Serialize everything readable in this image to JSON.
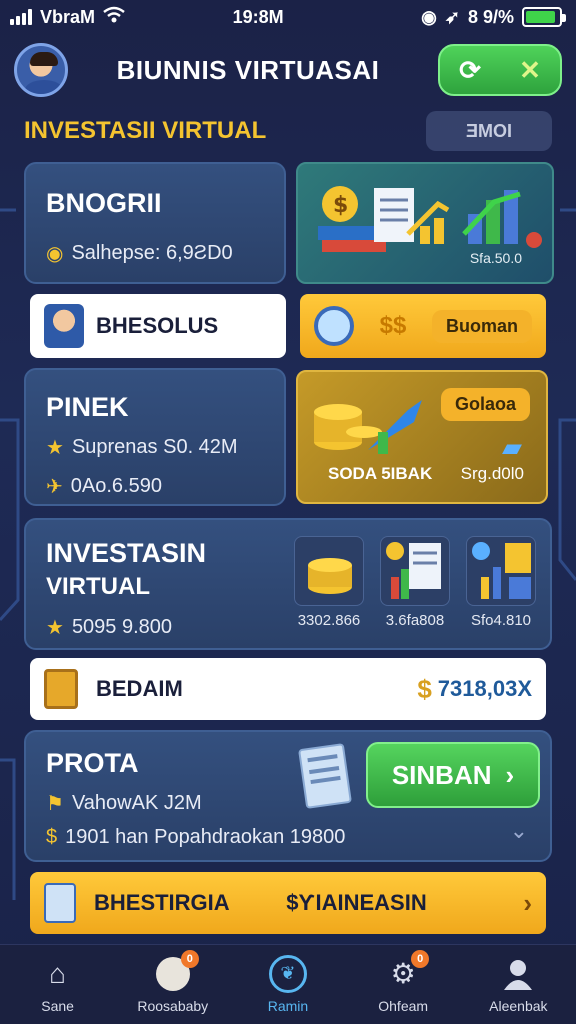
{
  "status_bar": {
    "carrier": "VbraM",
    "time": "19:8M",
    "battery_text": "8 9/%",
    "battery_level": 0.9
  },
  "header": {
    "title": "BIUNNIS VIRTUASAI",
    "left_icon": "avatar",
    "actions": [
      "refresh-icon",
      "tools-icon"
    ]
  },
  "section": {
    "title": "INVESTASII VIRTUAL",
    "tag": "ƎMOI"
  },
  "card_brogrii": {
    "title": "BNOGRII",
    "meta": "Salhepse: 6,9ƧD0",
    "image_caption": "Sfa.50.0"
  },
  "bar_bhesolus": {
    "label": "BHESOLUS",
    "yellow_label": "Buoman"
  },
  "card_pinek": {
    "title": "PINEK",
    "meta1": "Suprenas S0. 42M",
    "meta2": "0Ao.6.590",
    "image_label": "SODA 5IBAK",
    "badge": "Golaoa",
    "badge_caption": "Srg.d0l0"
  },
  "card_investasi": {
    "title_line1": "INVESTASIN",
    "title_line2": "VIRTUAL",
    "meta": "5095 9.800",
    "tiles": [
      {
        "icon": "coins-icon",
        "label": "3302.866"
      },
      {
        "icon": "chart-report-icon",
        "label": "3.6fa808"
      },
      {
        "icon": "growth-chart-icon",
        "label": "Sfo4.810"
      }
    ]
  },
  "bar_bedaim": {
    "label": "BEDAIM",
    "amount": "7318,03X"
  },
  "card_prota": {
    "title": "PROTA",
    "meta1": "VahowAK J2M",
    "meta2": "1901 han Popahdraokan 19800",
    "button_label": "SINBAN"
  },
  "bar_bhestirgia": {
    "label": "BHESTIRGIA",
    "value": "$ƳIAINEASIN"
  },
  "bottom_nav": [
    {
      "label": "Sane",
      "icon": "home-icon",
      "active": false,
      "badge": ""
    },
    {
      "label": "Roosababy",
      "icon": "piggy-icon",
      "active": false,
      "badge": "0"
    },
    {
      "label": "Ramin",
      "icon": "shop-icon",
      "active": true,
      "badge": ""
    },
    {
      "label": "Ohfeam",
      "icon": "gear-icon",
      "active": false,
      "badge": "0"
    },
    {
      "label": "Aleenbak",
      "icon": "profile-icon",
      "active": false,
      "badge": ""
    }
  ],
  "colors": {
    "accent_yellow": "#f4c430",
    "accent_green": "#3fd34a",
    "active_blue": "#58b6f0",
    "card_blue": "#34507f"
  }
}
